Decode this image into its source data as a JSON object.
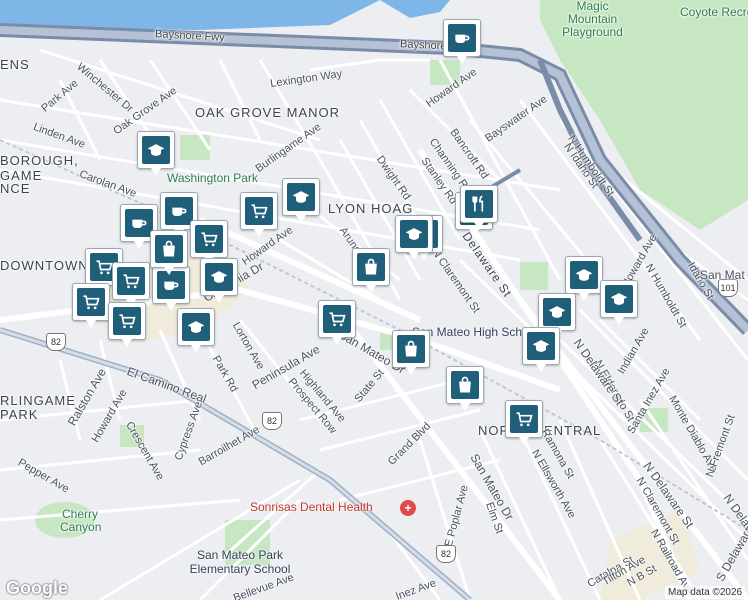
{
  "map": {
    "areas": [
      "OAK GROVE MANOR",
      "LYON HOAG",
      "DOWNTOWN",
      "NORTH CENTRAL",
      "BOROUGH,",
      "GAME",
      "NCE",
      "RLINGAME",
      "PARK",
      "ENS"
    ],
    "parks": [
      "Magic Mountain Playground",
      "Coyote Recreation",
      "Washington Park",
      "Cherry Canyon",
      "San Mateo Park Elementary School"
    ],
    "streets": [
      "Bayshore Fwy",
      "Lexington Way",
      "Park Ave",
      "Winchester Dr",
      "Oak Grove Ave",
      "Linden Ave",
      "Carolan Ave",
      "Burlingame Ave",
      "Howard Ave",
      "Bayswater Ave",
      "Bancroft Rd",
      "Channing Rd",
      "Dwight Rd",
      "Stanley Rd",
      "N Humboldt St",
      "N Idaho St",
      "N Delaware St",
      "N Claremont St",
      "Arundel Rd",
      "California Dr",
      "Peninsula Ave",
      "San Mateo Dr",
      "Lorton Ave",
      "Park Rd",
      "Highland Ave",
      "State St",
      "Prospect Row",
      "El Camino Real",
      "Ralston Ave",
      "Howard Ave",
      "Crescent Ave",
      "Cypress Ave",
      "Barroilhet Ave",
      "Pepper Ave",
      "Grand Blvd",
      "E Poplar Ave",
      "Elm St",
      "N Ellsworth Ave",
      "Ramona St",
      "N Eldorado St",
      "N Claremont St",
      "Indian Ave",
      "Santa Inez Ave",
      "Monte Diablo Ave",
      "N Fremont St",
      "N Railroad Ave",
      "Catalpa St",
      "Tilton Ave",
      "N B St",
      "S Delaware St",
      "Bellevue Ave",
      "Inez Ave",
      "N Humboldt St",
      "Idaho St"
    ],
    "poi": [
      "San Mateo High School",
      "Sonrisas Dental Health",
      "San Mateo Park Elementary School",
      "San Mat"
    ],
    "route_shields": [
      "82",
      "82",
      "82",
      "101"
    ],
    "attribution": "Map data ©2026",
    "logo": "Google"
  },
  "markers": [
    {
      "icon": "coffee-icon"
    },
    {
      "icon": "school-icon"
    },
    {
      "icon": "school-icon"
    },
    {
      "icon": "cart-icon"
    },
    {
      "icon": "coffee-icon"
    },
    {
      "icon": "cart-icon"
    },
    {
      "icon": "coffee-icon"
    },
    {
      "icon": "restaurant-icon"
    },
    {
      "icon": "restaurant-icon"
    },
    {
      "icon": "school-icon"
    },
    {
      "icon": "restaurant-icon"
    },
    {
      "icon": "shopping-bag-icon"
    },
    {
      "icon": "cart-icon"
    },
    {
      "icon": "cart-icon"
    },
    {
      "icon": "cart-icon"
    },
    {
      "icon": "coffee-icon"
    },
    {
      "icon": "cart-icon"
    },
    {
      "icon": "school-icon"
    },
    {
      "icon": "cart-icon"
    },
    {
      "icon": "shopping-bag-icon"
    },
    {
      "icon": "shopping-bag-icon"
    },
    {
      "icon": "school-icon"
    },
    {
      "icon": "school-icon"
    },
    {
      "icon": "school-icon"
    },
    {
      "icon": "school-icon"
    },
    {
      "icon": "cart-icon"
    },
    {
      "icon": "school-icon"
    },
    {
      "icon": "shopping-bag-icon"
    }
  ],
  "colors": {
    "water": "#7fb6e8",
    "park": "#c7e6c2",
    "freeway": "#8a9bb5",
    "road": "#ffffff",
    "marker_icon": "#1f5f7a"
  }
}
